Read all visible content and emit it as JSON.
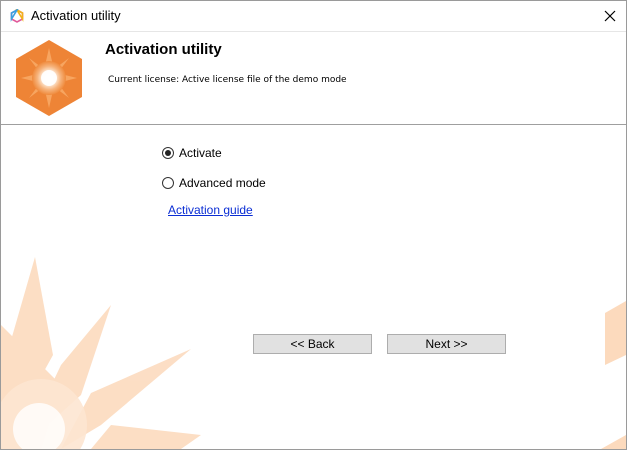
{
  "window": {
    "title": "Activation utility",
    "app_icon": "hexagon-logo-icon",
    "close_icon": "close-icon"
  },
  "header": {
    "title": "Activation utility",
    "subtitle": "Current license: Active license file of the demo mode",
    "logo_icon": "sun-hexagon-logo"
  },
  "options": {
    "activate_label": "Activate",
    "advanced_label": "Advanced mode",
    "selected": "Activate"
  },
  "links": {
    "guide": "Activation guide"
  },
  "buttons": {
    "back": "<< Back",
    "next": "Next >>"
  },
  "colors": {
    "accent_orange": "#ef8a3c",
    "decor_peach": "#fbd3b1",
    "link_blue": "#0a2dd4"
  }
}
